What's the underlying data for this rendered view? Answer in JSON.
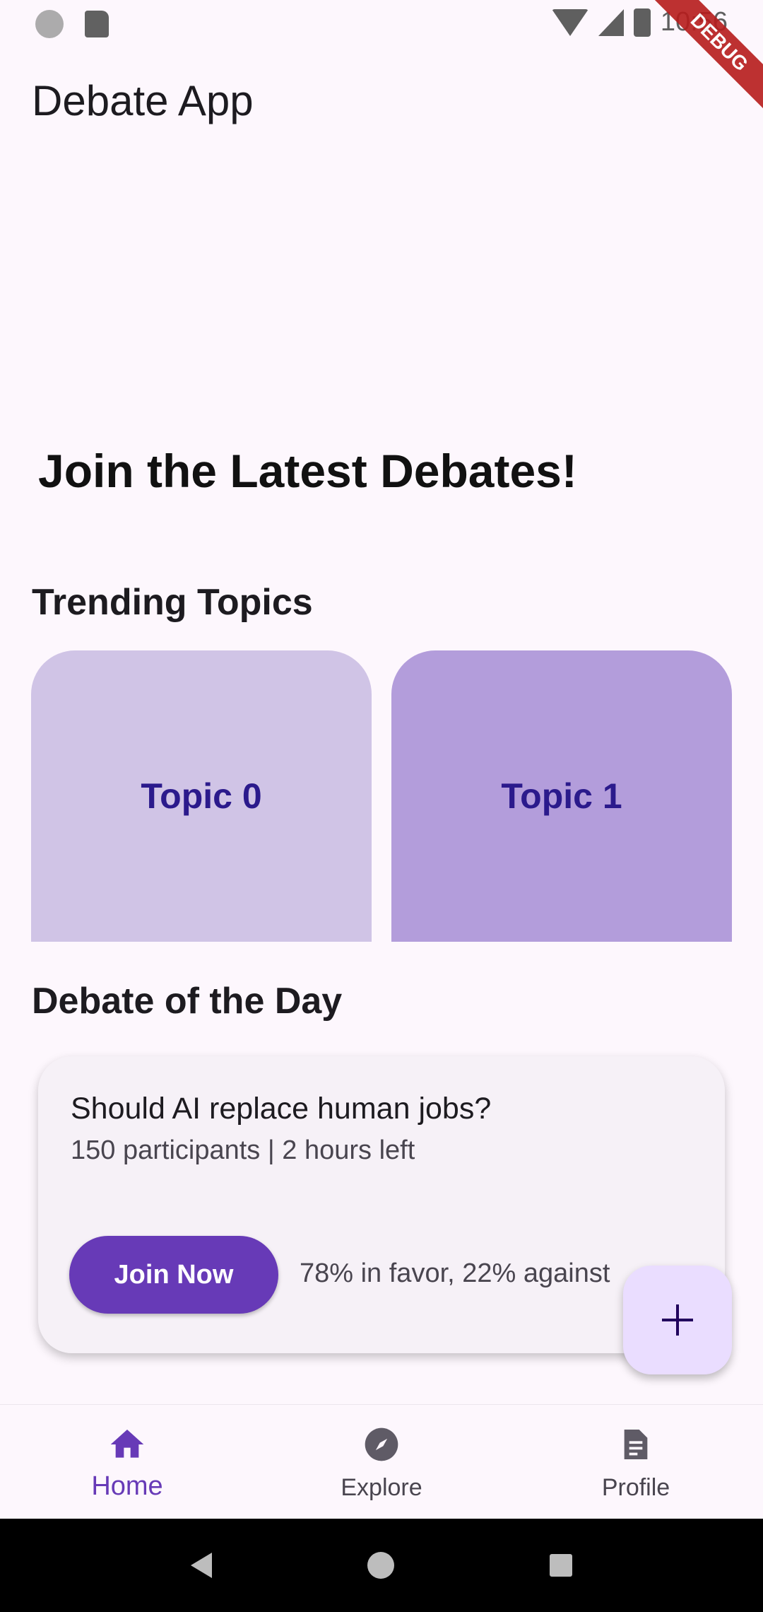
{
  "status_bar": {
    "time": "10:56",
    "debug_label": "DEBUG"
  },
  "app_bar": {
    "title": "Debate App"
  },
  "hero": {
    "title": "Join the Latest Debates!"
  },
  "trending": {
    "title": "Trending Topics",
    "topics": [
      {
        "label": "Topic 0",
        "color": "#d0c4e6"
      },
      {
        "label": "Topic 1",
        "color": "#b39ddb"
      }
    ]
  },
  "debate_of_day": {
    "title": "Debate of the Day",
    "question": "Should AI replace human jobs?",
    "meta": "150 participants | 2 hours left",
    "join_label": "Join Now",
    "stats": "78% in favor, 22% against"
  },
  "fab": {
    "icon": "plus-icon"
  },
  "bottom_nav": {
    "items": [
      {
        "label": "Home",
        "icon": "home-icon",
        "active": true
      },
      {
        "label": "Explore",
        "icon": "compass-icon",
        "active": false
      },
      {
        "label": "Profile",
        "icon": "document-icon",
        "active": false
      }
    ]
  },
  "colors": {
    "accent": "#673ab7",
    "fab_bg": "#eaddff",
    "background": "#fdf7fd"
  }
}
